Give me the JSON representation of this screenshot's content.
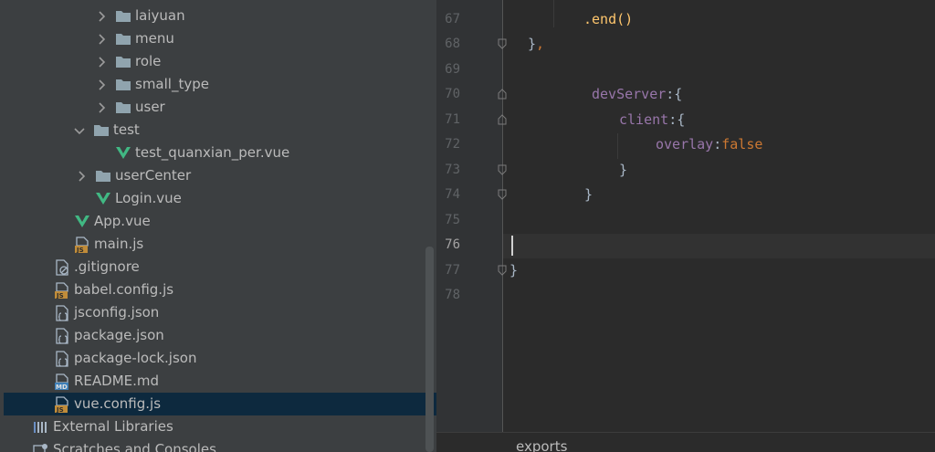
{
  "project_tree": {
    "items": [
      {
        "label": "laiyuan",
        "type": "folder",
        "expanded": false
      },
      {
        "label": "menu",
        "type": "folder",
        "expanded": false
      },
      {
        "label": "role",
        "type": "folder",
        "expanded": false
      },
      {
        "label": "small_type",
        "type": "folder",
        "expanded": false
      },
      {
        "label": "user",
        "type": "folder",
        "expanded": false
      },
      {
        "label": "test",
        "type": "folder",
        "expanded": true
      },
      {
        "label": "test_quanxian_per.vue",
        "type": "vue"
      },
      {
        "label": "userCenter",
        "type": "folder",
        "expanded": false
      },
      {
        "label": "Login.vue",
        "type": "vue"
      },
      {
        "label": "App.vue",
        "type": "vue"
      },
      {
        "label": "main.js",
        "type": "js"
      },
      {
        "label": ".gitignore",
        "type": "ignore"
      },
      {
        "label": "babel.config.js",
        "type": "js"
      },
      {
        "label": "jsconfig.json",
        "type": "json"
      },
      {
        "label": "package.json",
        "type": "json"
      },
      {
        "label": "package-lock.json",
        "type": "json"
      },
      {
        "label": "README.md",
        "type": "md"
      },
      {
        "label": "vue.config.js",
        "type": "js",
        "selected": true
      },
      {
        "label": "External Libraries",
        "type": "libraries"
      },
      {
        "label": "Scratches and Consoles",
        "type": "scratches"
      }
    ],
    "icon_text": {
      "js": "JS",
      "md": "MD"
    }
  },
  "editor": {
    "line_numbers": [
      "67",
      "68",
      "69",
      "70",
      "71",
      "72",
      "73",
      "74",
      "75",
      "76",
      "77",
      "78"
    ],
    "current_line": "76",
    "code": {
      "l67": ".end()",
      "l68_brace": "},",
      "l68_comma": ",",
      "l70_key": "devServer",
      "l70_punc": ":{",
      "l71_key": "client",
      "l71_punc": ":{",
      "l72_key": "overlay",
      "l72_colon": ":",
      "l72_val": "false",
      "l73": "}",
      "l74": "}",
      "l77": "}"
    },
    "breadcrumb": "exports"
  },
  "colors": {
    "tree_bg": "#3c3f41",
    "editor_bg": "#2b2b2b",
    "selection": "#0d293e",
    "keyword_orange": "#cc7832",
    "property_purple": "#9876aa",
    "method_yellow": "#ffc66d",
    "vue_green": "#41b883",
    "folder_gray": "#90a4ae"
  }
}
